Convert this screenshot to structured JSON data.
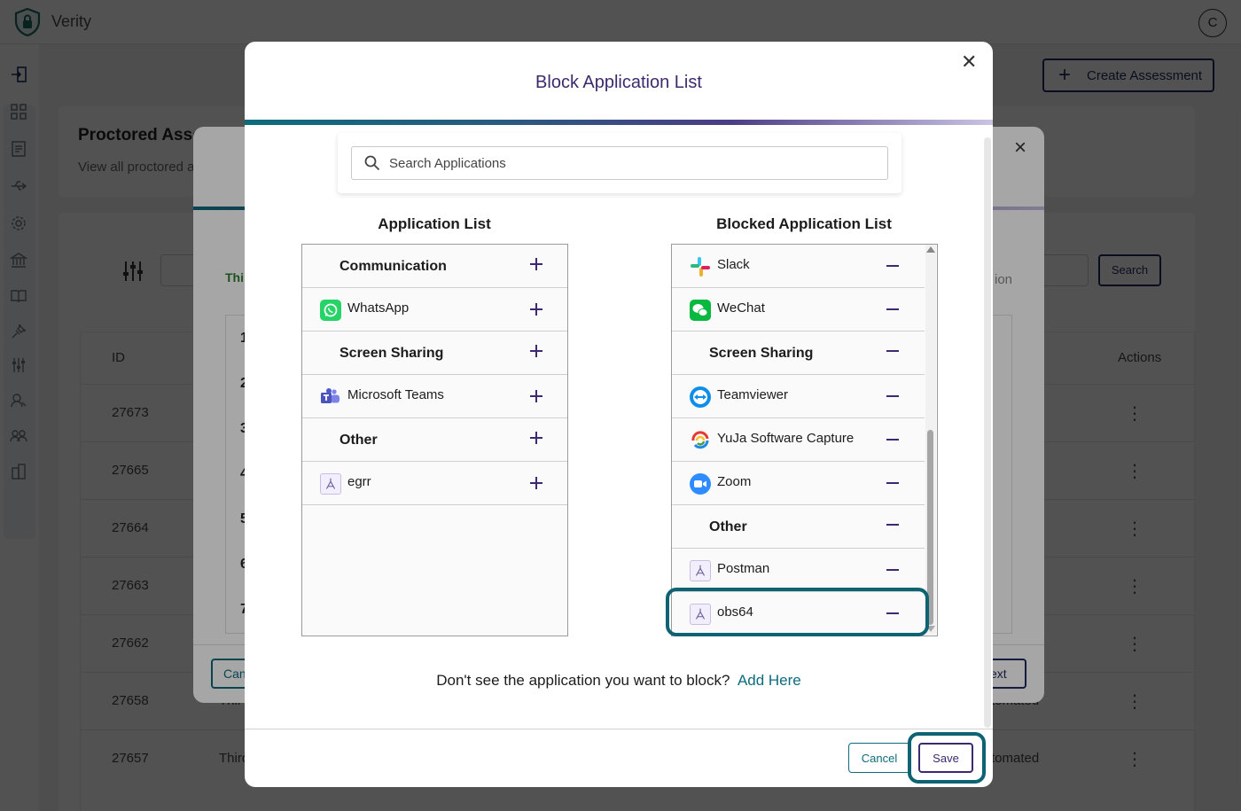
{
  "app": {
    "title": "Verity",
    "avatar_initial": "C"
  },
  "background": {
    "create_button": "Create Assessment",
    "page_heading": "Proctored Asse",
    "page_subheading": "View all proctored a",
    "search_button": "Search",
    "columns": {
      "id": "ID",
      "actions": "Actions"
    },
    "rows": [
      {
        "id": "27673"
      },
      {
        "id": "27665"
      },
      {
        "id": "27664"
      },
      {
        "id": "27663"
      },
      {
        "id": "27662"
      },
      {
        "id": "27658",
        "type_fragment": "Thir",
        "mode_fragment": "tomated"
      },
      {
        "id": "27657",
        "type_fragment": "Third",
        "mode_fragment": "tomated"
      }
    ],
    "back_modal": {
      "green_text": "Thi",
      "side_numbers": [
        "1",
        "2",
        "3",
        "4",
        "5",
        "6",
        "7"
      ],
      "right_text": "ion",
      "cancel_fragment": "Can",
      "next_fragment": "ext"
    }
  },
  "modal": {
    "title": "Block Application List",
    "search_placeholder": "Search Applications",
    "application_list": {
      "title": "Application List",
      "rows": [
        {
          "type": "category",
          "label": "Communication"
        },
        {
          "type": "app",
          "label": "WhatsApp",
          "icon": "whatsapp-icon"
        },
        {
          "type": "category",
          "label": "Screen Sharing"
        },
        {
          "type": "app",
          "label": "Microsoft Teams",
          "icon": "microsoft-teams-icon"
        },
        {
          "type": "category",
          "label": "Other"
        },
        {
          "type": "app",
          "label": "egrr",
          "icon": "generic-app-icon"
        }
      ]
    },
    "blocked_list": {
      "title": "Blocked Application List",
      "rows": [
        {
          "type": "app",
          "label": "Slack",
          "icon": "slack-icon"
        },
        {
          "type": "app",
          "label": "WeChat",
          "icon": "wechat-icon"
        },
        {
          "type": "category",
          "label": "Screen Sharing"
        },
        {
          "type": "app",
          "label": "Teamviewer",
          "icon": "teamviewer-icon"
        },
        {
          "type": "app",
          "label": "YuJa Software Capture",
          "icon": "yuja-icon"
        },
        {
          "type": "app",
          "label": "Zoom",
          "icon": "zoom-icon"
        },
        {
          "type": "category",
          "label": "Other"
        },
        {
          "type": "app",
          "label": "Postman",
          "icon": "generic-app-icon"
        },
        {
          "type": "app",
          "label": "obs64",
          "icon": "generic-app-icon"
        }
      ]
    },
    "add_prompt": "Don't see the application you want to block?",
    "add_link": "Add Here",
    "cancel_label": "Cancel",
    "save_label": "Save"
  },
  "colors": {
    "brand_teal": "#0c6c7c",
    "brand_purple": "#3d2a6e",
    "highlight": "#0e6372"
  }
}
